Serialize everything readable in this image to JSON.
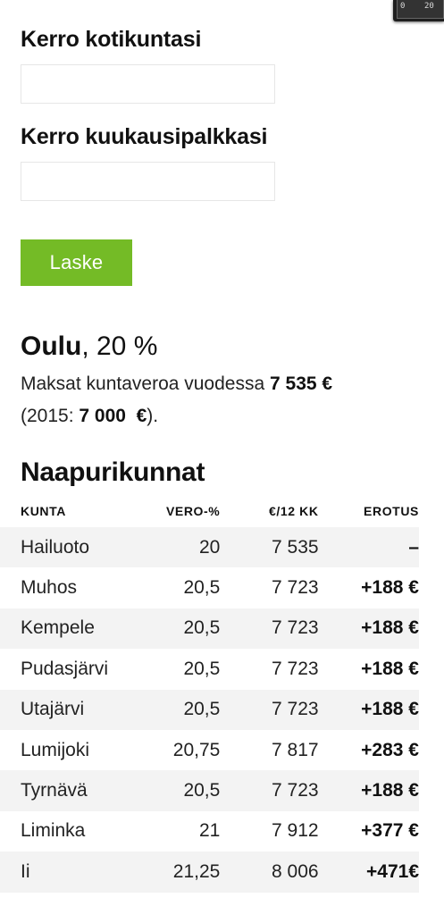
{
  "ruler": {
    "ticks": [
      "0",
      "20"
    ]
  },
  "form": {
    "municipality_label": "Kerro kotikuntasi",
    "municipality_value": "",
    "salary_label": "Kerro kuukausipalkkasi",
    "salary_value": "",
    "calculate_label": "Laske"
  },
  "result": {
    "city": "Oulu",
    "rate": ", 20 %",
    "sentence_prefix": "Maksat kuntaveroa vuodessa ",
    "annual_tax": "7 535 €",
    "prev_prefix": "(2015: ",
    "prev_value": "7 000  €",
    "prev_suffix": ")."
  },
  "neighbors": {
    "title": "Naapurikunnat",
    "columns": [
      "KUNTA",
      "VERO-%",
      "€/12 KK",
      "EROTUS"
    ],
    "rows": [
      {
        "name": "Hailuoto",
        "rate": "20",
        "annual": "7 535",
        "diff": "–"
      },
      {
        "name": "Muhos",
        "rate": "20,5",
        "annual": "7 723",
        "diff": "+188 €"
      },
      {
        "name": "Kempele",
        "rate": "20,5",
        "annual": "7 723",
        "diff": "+188 €"
      },
      {
        "name": "Pudasjärvi",
        "rate": "20,5",
        "annual": "7 723",
        "diff": "+188 €"
      },
      {
        "name": "Utajärvi",
        "rate": "20,5",
        "annual": "7 723",
        "diff": "+188 €"
      },
      {
        "name": "Lumijoki",
        "rate": "20,75",
        "annual": "7 817",
        "diff": "+283 €"
      },
      {
        "name": "Tyrnävä",
        "rate": "20,5",
        "annual": "7 723",
        "diff": "+188 €"
      },
      {
        "name": "Liminka",
        "rate": "21",
        "annual": "7 912",
        "diff": "+377 €"
      },
      {
        "name": "Ii",
        "rate": "21,25",
        "annual": "8 006",
        "diff": "+471€"
      }
    ]
  },
  "colors": {
    "accent_button": "#74bb26",
    "stripe": "#f3f3f3"
  }
}
